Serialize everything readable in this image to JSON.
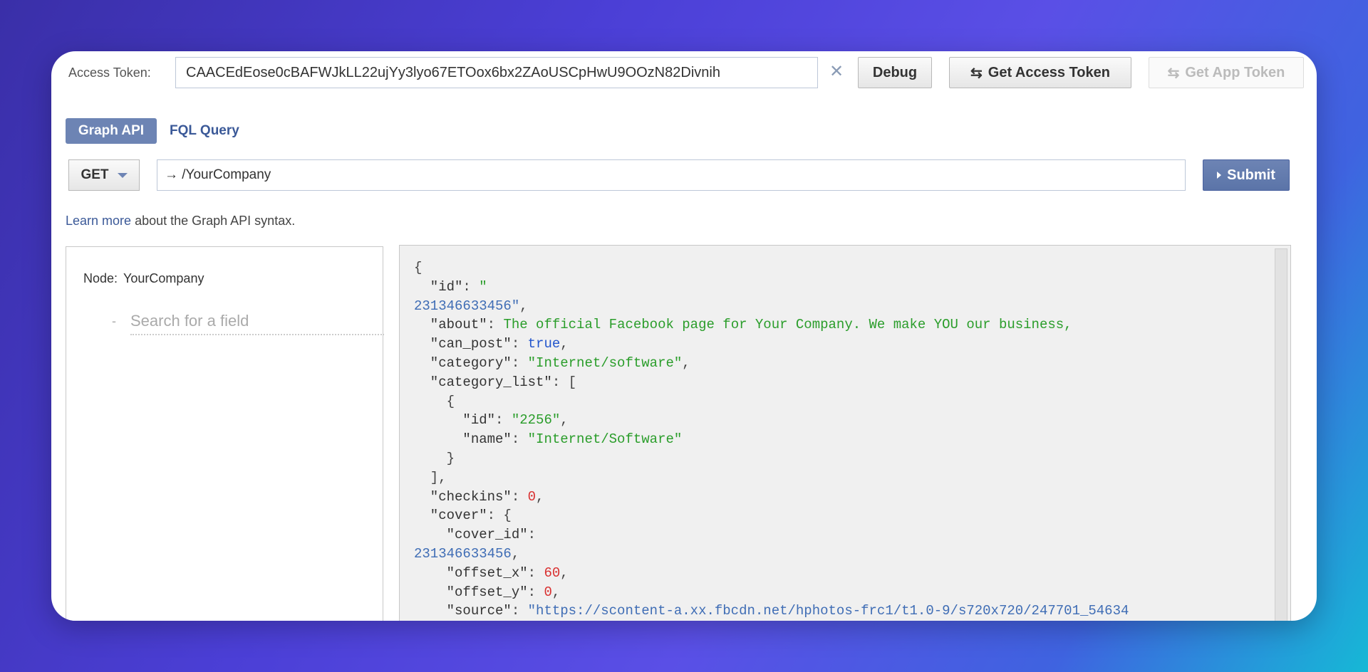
{
  "token": {
    "label": "Access Token:",
    "value": "CAACEdEose0cBAFWJkLL22ujYy3lyo67ETOox6bx2ZAoUSCpHwU9OOzN82Divnih",
    "clear_icon": "close-icon"
  },
  "buttons": {
    "debug": "Debug",
    "get_access_token": "Get Access Token",
    "get_app_token": "Get App Token",
    "submit": "Submit"
  },
  "tabs": {
    "graph_api": "Graph API",
    "fql_query": "FQL Query"
  },
  "query": {
    "method": "GET",
    "path": "→ /YourCompany"
  },
  "help": {
    "link": "Learn more",
    "text": " about the Graph API syntax."
  },
  "explorer": {
    "node_label": "Node:",
    "node_value": "YourCompany",
    "search_dash": "-",
    "search_placeholder": "Search for a field"
  },
  "response_lines": [
    [
      {
        "t": "p",
        "v": "{"
      }
    ],
    [
      {
        "t": "k",
        "v": "  \"id\""
      },
      {
        "t": "p",
        "v": ": "
      },
      {
        "t": "s",
        "v": "\""
      }
    ],
    [
      {
        "t": "sb",
        "v": "231346633456\""
      },
      {
        "t": "p",
        "v": ","
      }
    ],
    [
      {
        "t": "k",
        "v": "  \"about\""
      },
      {
        "t": "p",
        "v": ": "
      },
      {
        "t": "s",
        "v": "The official Facebook page for Your Company. We make YOU our business,"
      }
    ],
    [
      {
        "t": "k",
        "v": "  \"can_post\""
      },
      {
        "t": "p",
        "v": ": "
      },
      {
        "t": "b",
        "v": "true"
      },
      {
        "t": "p",
        "v": ","
      }
    ],
    [
      {
        "t": "k",
        "v": "  \"category\""
      },
      {
        "t": "p",
        "v": ": "
      },
      {
        "t": "s",
        "v": "\"Internet/software\""
      },
      {
        "t": "p",
        "v": ","
      }
    ],
    [
      {
        "t": "k",
        "v": "  \"category_list\""
      },
      {
        "t": "p",
        "v": ": ["
      }
    ],
    [
      {
        "t": "p",
        "v": "    {"
      }
    ],
    [
      {
        "t": "k",
        "v": "      \"id\""
      },
      {
        "t": "p",
        "v": ": "
      },
      {
        "t": "s",
        "v": "\"2256\""
      },
      {
        "t": "p",
        "v": ","
      }
    ],
    [
      {
        "t": "k",
        "v": "      \"name\""
      },
      {
        "t": "p",
        "v": ": "
      },
      {
        "t": "s",
        "v": "\"Internet/Software\""
      }
    ],
    [
      {
        "t": "p",
        "v": "    }"
      }
    ],
    [
      {
        "t": "p",
        "v": "  ],"
      }
    ],
    [
      {
        "t": "k",
        "v": "  \"checkins\""
      },
      {
        "t": "p",
        "v": ": "
      },
      {
        "t": "n",
        "v": "0"
      },
      {
        "t": "p",
        "v": ","
      }
    ],
    [
      {
        "t": "k",
        "v": "  \"cover\""
      },
      {
        "t": "p",
        "v": ": {"
      }
    ],
    [
      {
        "t": "k",
        "v": "    \"cover_id\""
      },
      {
        "t": "p",
        "v": ":"
      }
    ],
    [
      {
        "t": "sb",
        "v": "231346633456"
      },
      {
        "t": "p",
        "v": ","
      }
    ],
    [
      {
        "t": "k",
        "v": "    \"offset_x\""
      },
      {
        "t": "p",
        "v": ": "
      },
      {
        "t": "n",
        "v": "60"
      },
      {
        "t": "p",
        "v": ","
      }
    ],
    [
      {
        "t": "k",
        "v": "    \"offset_y\""
      },
      {
        "t": "p",
        "v": ": "
      },
      {
        "t": "n",
        "v": "0"
      },
      {
        "t": "p",
        "v": ","
      }
    ],
    [
      {
        "t": "k",
        "v": "    \"source\""
      },
      {
        "t": "p",
        "v": ": "
      },
      {
        "t": "sb",
        "v": "\"https://scontent-a.xx.fbcdn.net/hphotos-frc1/t1.0-9/s720x720/247701_54634"
      }
    ]
  ],
  "colors": {
    "accent": "#6d84b4",
    "link": "#3b5998",
    "json_string": "#2a9d2a",
    "json_number": "#d93030",
    "json_bool": "#2255cc"
  }
}
